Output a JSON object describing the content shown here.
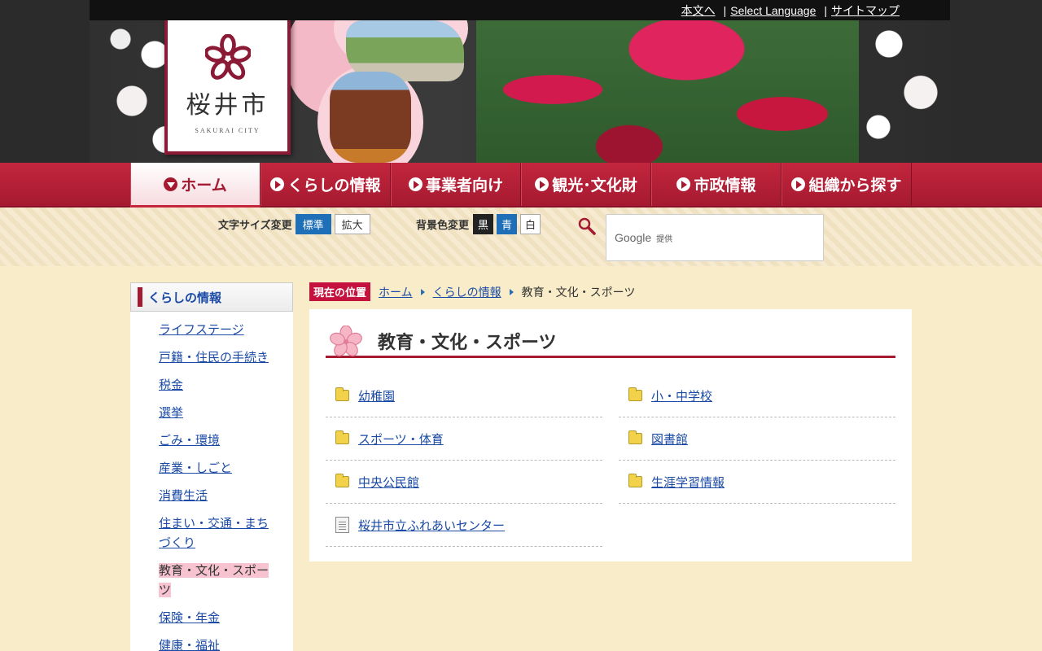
{
  "topbar": {
    "skip_link": "本文へ",
    "select_language": "Select Language",
    "sitemap": "サイトマップ"
  },
  "logo": {
    "name": "桜井市",
    "sub": "SAKURAI CITY"
  },
  "nav": {
    "items": [
      {
        "label": "ホーム"
      },
      {
        "label": "くらしの情報"
      },
      {
        "label": "事業者向け"
      },
      {
        "label": "観光･文化財"
      },
      {
        "label": "市政情報"
      },
      {
        "label": "組織から探す"
      }
    ]
  },
  "tools": {
    "font_size_label": "文字サイズ変更",
    "font_standard": "標準",
    "font_large": "拡大",
    "bg_label": "背景色変更",
    "bg_black": "黒",
    "bg_blue": "青",
    "bg_white": "白",
    "search_brand": "Google",
    "search_provided": "提供"
  },
  "sidebar": {
    "heading": "くらしの情報",
    "items": [
      {
        "label": "ライフステージ"
      },
      {
        "label": "戸籍・住民の手続き"
      },
      {
        "label": "税金"
      },
      {
        "label": "選挙"
      },
      {
        "label": "ごみ・環境"
      },
      {
        "label": "産業・しごと"
      },
      {
        "label": "消費生活"
      },
      {
        "label": "住まい・交通・まちづくり"
      },
      {
        "label": "教育・文化・スポーツ"
      },
      {
        "label": "保険・年金"
      },
      {
        "label": "健康・福祉"
      }
    ]
  },
  "breadcrumb": {
    "label": "現在の位置",
    "home": "ホーム",
    "parent": "くらしの情報",
    "current": "教育・文化・スポーツ"
  },
  "main": {
    "title": "教育・文化・スポーツ",
    "links": [
      {
        "label": "幼稚園",
        "icon": "folder-icon"
      },
      {
        "label": "小・中学校",
        "icon": "folder-icon"
      },
      {
        "label": "スポーツ・体育",
        "icon": "folder-icon"
      },
      {
        "label": "図書館",
        "icon": "folder-icon"
      },
      {
        "label": "中央公民館",
        "icon": "folder-icon"
      },
      {
        "label": "生涯学習情報",
        "icon": "folder-icon"
      },
      {
        "label": "桜井市立ふれあいセンター",
        "icon": "page-icon"
      }
    ]
  },
  "colors": {
    "accent": "#a51a30",
    "link": "#1a4aa6",
    "background": "#f8edc8"
  }
}
